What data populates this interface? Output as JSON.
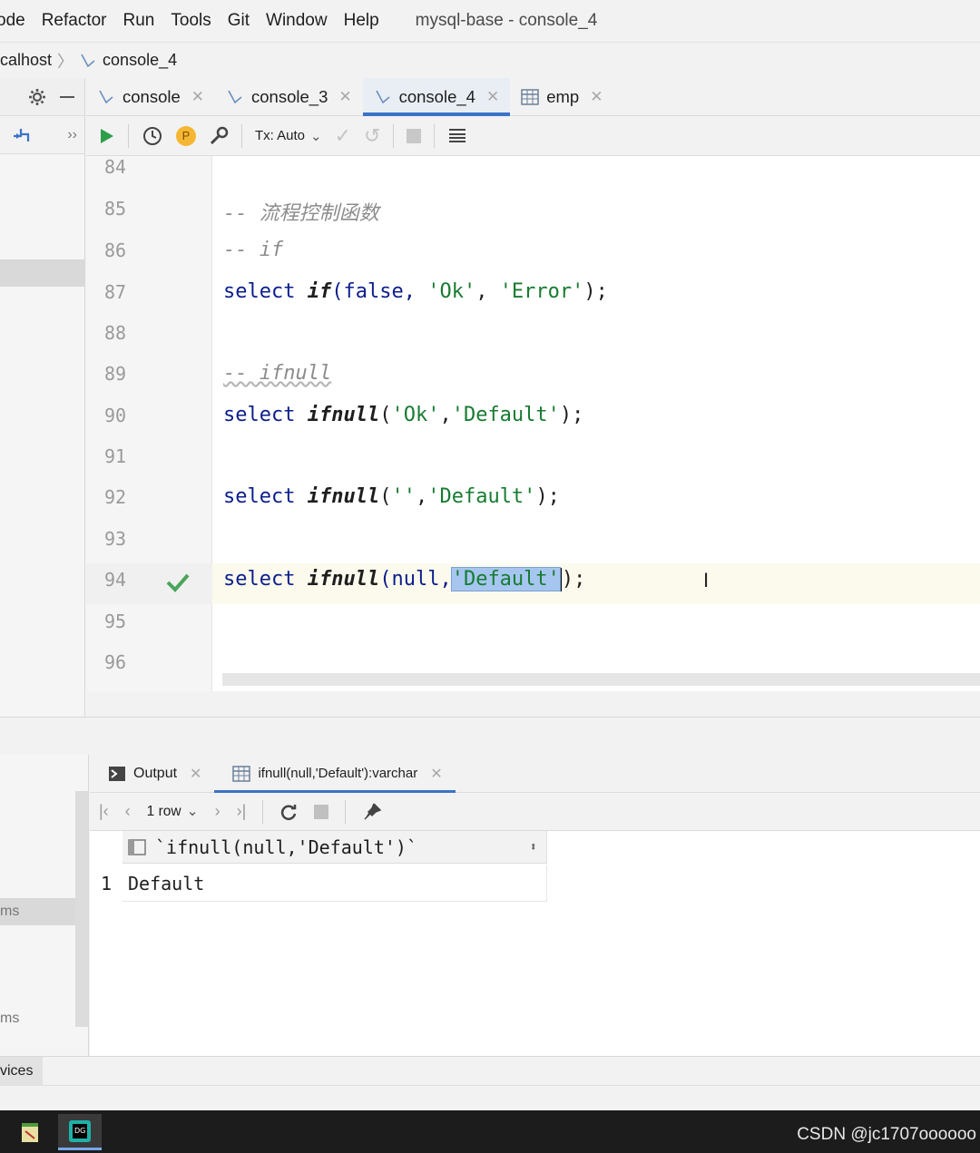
{
  "menu": {
    "items": [
      "ode",
      "Refactor",
      "Run",
      "Tools",
      "Git",
      "Window",
      "Help"
    ],
    "window_title": "mysql-base - console_4"
  },
  "breadcrumb": {
    "root": "calhost",
    "leaf": "console_4"
  },
  "tabs": [
    {
      "label": "console",
      "icon": "console-icon"
    },
    {
      "label": "console_3",
      "icon": "console-icon"
    },
    {
      "label": "console_4",
      "icon": "console-icon",
      "active": true
    },
    {
      "label": "emp",
      "icon": "table-icon"
    }
  ],
  "toolbar": {
    "tx_mode": "Tx: Auto",
    "p_badge": "P"
  },
  "editor": {
    "lines": [
      {
        "n": "84",
        "code": ""
      },
      {
        "n": "85",
        "comment": "-- 流程控制函数"
      },
      {
        "n": "86",
        "comment": "-- if"
      },
      {
        "n": "87",
        "kw": "select",
        "fn": "if",
        "rest_a": "(false, ",
        "s1": "'Ok'",
        "rest_b": ", ",
        "s2": "'Error'",
        "rest_c": ");"
      },
      {
        "n": "88",
        "code": ""
      },
      {
        "n": "89",
        "comment": "-- ifnull"
      },
      {
        "n": "90",
        "kw": "select",
        "fn": "ifnull",
        "rest_a": "(",
        "s1": "'Ok'",
        "rest_b": ",",
        "s2": "'Default'",
        "rest_c": ");"
      },
      {
        "n": "91",
        "code": ""
      },
      {
        "n": "92",
        "kw": "select",
        "fn": "ifnull",
        "rest_a": "(",
        "s1": "''",
        "rest_b": ",",
        "s2": "'Default'",
        "rest_c": ");"
      },
      {
        "n": "93",
        "code": ""
      },
      {
        "n": "94",
        "kw": "select",
        "fn": "ifnull",
        "rest_a": "(null,",
        "s2": "'Default'",
        "rest_c": ");",
        "current": true
      },
      {
        "n": "95",
        "code": ""
      },
      {
        "n": "96",
        "code": ""
      }
    ]
  },
  "results": {
    "tabs": [
      {
        "label": "Output"
      },
      {
        "label": "ifnull(null,'Default'):varchar",
        "active": true
      }
    ],
    "row_count": "1 row",
    "column_header": "`ifnull(null,'Default')`",
    "rows": [
      {
        "num": "1",
        "value": "Default"
      }
    ],
    "left_items": [
      "ms",
      "ms"
    ]
  },
  "bottom": {
    "services_label": "vices"
  },
  "watermark": "CSDN @jc1707oooooo",
  "colors": {
    "accent": "#3b73c6",
    "run_green": "#2e9e4a",
    "keyword": "#0b1e8c",
    "string": "#177b30"
  }
}
